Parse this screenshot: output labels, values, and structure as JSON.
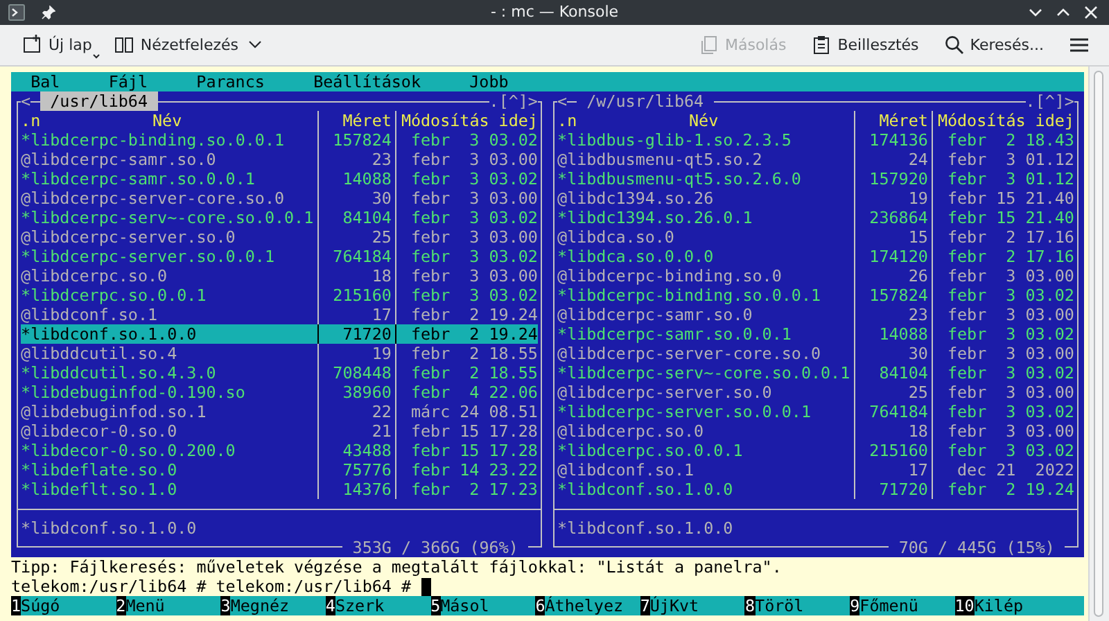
{
  "window": {
    "title": "- : mc — Konsole"
  },
  "toolbar": {
    "left": [
      {
        "kind": "new_tab",
        "label": "Új lap",
        "disabled": false
      },
      {
        "kind": "split_view",
        "label": "Nézetfelezés",
        "disabled": false
      }
    ],
    "right": [
      {
        "kind": "copy",
        "label": "Másolás",
        "disabled": true
      },
      {
        "kind": "paste",
        "label": "Beillesztés",
        "disabled": false
      },
      {
        "kind": "search",
        "label": "Keresés...",
        "disabled": false
      },
      {
        "kind": "menu",
        "disabled": false
      }
    ]
  },
  "menu_bar": [
    "Bal",
    "Fájl",
    "Parancs",
    "Beállítások",
    "Jobb"
  ],
  "left_panel": {
    "nav": "<",
    "path": "/usr/lib64",
    "active": true,
    "history": ".[^]>",
    "columns": [
      ".n",
      "Név",
      "Méret",
      "Módosítás idej"
    ],
    "files": [
      {
        "name": "*libdcerpc-binding.so.0.0.1",
        "size": "157824",
        "modified": "febr  3 03.02",
        "kind": "executable",
        "selected": false
      },
      {
        "name": "@libdcerpc-samr.so.0",
        "size": "23",
        "modified": "febr  3 03.00",
        "kind": "symlink",
        "selected": false
      },
      {
        "name": "*libdcerpc-samr.so.0.0.1",
        "size": "14088",
        "modified": "febr  3 03.02",
        "kind": "executable",
        "selected": false
      },
      {
        "name": "@libdcerpc-server-core.so.0",
        "size": "30",
        "modified": "febr  3 03.00",
        "kind": "symlink",
        "selected": false
      },
      {
        "name": "*libdcerpc-serv~-core.so.0.0.1",
        "size": "84104",
        "modified": "febr  3 03.02",
        "kind": "executable",
        "selected": false
      },
      {
        "name": "@libdcerpc-server.so.0",
        "size": "25",
        "modified": "febr  3 03.00",
        "kind": "symlink",
        "selected": false
      },
      {
        "name": "*libdcerpc-server.so.0.0.1",
        "size": "764184",
        "modified": "febr  3 03.02",
        "kind": "executable",
        "selected": false
      },
      {
        "name": "@libdcerpc.so.0",
        "size": "18",
        "modified": "febr  3 03.00",
        "kind": "symlink",
        "selected": false
      },
      {
        "name": "*libdcerpc.so.0.0.1",
        "size": "215160",
        "modified": "febr  3 03.02",
        "kind": "executable",
        "selected": false
      },
      {
        "name": "@libdconf.so.1",
        "size": "17",
        "modified": "febr  2 19.24",
        "kind": "symlink",
        "selected": false
      },
      {
        "name": "*libdconf.so.1.0.0",
        "size": "71720",
        "modified": "febr  2 19.24",
        "kind": "executable",
        "selected": true
      },
      {
        "name": "@libddcutil.so.4",
        "size": "19",
        "modified": "febr  2 18.55",
        "kind": "symlink",
        "selected": false
      },
      {
        "name": "*libddcutil.so.4.3.0",
        "size": "708448",
        "modified": "febr  2 18.55",
        "kind": "executable",
        "selected": false
      },
      {
        "name": "*libdebuginfod-0.190.so",
        "size": "38960",
        "modified": "febr  4 22.06",
        "kind": "executable",
        "selected": false
      },
      {
        "name": "@libdebuginfod.so.1",
        "size": "22",
        "modified": "márc 24 08.51",
        "kind": "symlink",
        "selected": false
      },
      {
        "name": "@libdecor-0.so.0",
        "size": "21",
        "modified": "febr 15 17.28",
        "kind": "symlink",
        "selected": false
      },
      {
        "name": "*libdecor-0.so.0.200.0",
        "size": "43488",
        "modified": "febr 15 17.28",
        "kind": "executable",
        "selected": false
      },
      {
        "name": "*libdeflate.so.0",
        "size": "75776",
        "modified": "febr 14 23.22",
        "kind": "executable",
        "selected": false
      },
      {
        "name": "*libdeflt.so.1.0",
        "size": "14376",
        "modified": "febr  2 17.23",
        "kind": "executable",
        "selected": false
      }
    ],
    "mini_status": "*libdconf.so.1.0.0",
    "disk_usage": "353G / 366G (96%)"
  },
  "right_panel": {
    "nav": "<",
    "path": "/w/usr/lib64",
    "active": false,
    "history": ".[^]>",
    "columns": [
      ".n",
      "Név",
      "Méret",
      "Módosítás idej"
    ],
    "files": [
      {
        "name": "*libdbus-glib-1.so.2.3.5",
        "size": "174136",
        "modified": "febr  2 18.43",
        "kind": "executable",
        "selected": false
      },
      {
        "name": "@libdbusmenu-qt5.so.2",
        "size": "24",
        "modified": "febr  3 01.12",
        "kind": "symlink",
        "selected": false
      },
      {
        "name": "*libdbusmenu-qt5.so.2.6.0",
        "size": "157920",
        "modified": "febr  3 01.12",
        "kind": "executable",
        "selected": false
      },
      {
        "name": "@libdc1394.so.26",
        "size": "19",
        "modified": "febr 15 21.40",
        "kind": "symlink",
        "selected": false
      },
      {
        "name": "*libdc1394.so.26.0.1",
        "size": "236864",
        "modified": "febr 15 21.40",
        "kind": "executable",
        "selected": false
      },
      {
        "name": "@libdca.so.0",
        "size": "15",
        "modified": "febr  2 17.16",
        "kind": "symlink",
        "selected": false
      },
      {
        "name": "*libdca.so.0.0.0",
        "size": "174120",
        "modified": "febr  2 17.16",
        "kind": "executable",
        "selected": false
      },
      {
        "name": "@libdcerpc-binding.so.0",
        "size": "26",
        "modified": "febr  3 03.00",
        "kind": "symlink",
        "selected": false
      },
      {
        "name": "*libdcerpc-binding.so.0.0.1",
        "size": "157824",
        "modified": "febr  3 03.02",
        "kind": "executable",
        "selected": false
      },
      {
        "name": "@libdcerpc-samr.so.0",
        "size": "23",
        "modified": "febr  3 03.00",
        "kind": "symlink",
        "selected": false
      },
      {
        "name": "*libdcerpc-samr.so.0.0.1",
        "size": "14088",
        "modified": "febr  3 03.02",
        "kind": "executable",
        "selected": false
      },
      {
        "name": "@libdcerpc-server-core.so.0",
        "size": "30",
        "modified": "febr  3 03.00",
        "kind": "symlink",
        "selected": false
      },
      {
        "name": "*libdcerpc-serv~-core.so.0.0.1",
        "size": "84104",
        "modified": "febr  3 03.02",
        "kind": "executable",
        "selected": false
      },
      {
        "name": "@libdcerpc-server.so.0",
        "size": "25",
        "modified": "febr  3 03.00",
        "kind": "symlink",
        "selected": false
      },
      {
        "name": "*libdcerpc-server.so.0.0.1",
        "size": "764184",
        "modified": "febr  3 03.02",
        "kind": "executable",
        "selected": false
      },
      {
        "name": "@libdcerpc.so.0",
        "size": "18",
        "modified": "febr  3 03.00",
        "kind": "symlink",
        "selected": false
      },
      {
        "name": "*libdcerpc.so.0.0.1",
        "size": "215160",
        "modified": "febr  3 03.02",
        "kind": "executable",
        "selected": false
      },
      {
        "name": "@libdconf.so.1",
        "size": "17",
        "modified": " dec 21  2022",
        "kind": "symlink",
        "selected": false
      },
      {
        "name": "*libdconf.so.1.0.0",
        "size": "71720",
        "modified": "febr  2 19.24",
        "kind": "executable",
        "selected": false
      }
    ],
    "mini_status": "*libdconf.so.1.0.0",
    "disk_usage": "70G / 445G (15%)"
  },
  "hint": "Tipp: Fájlkeresés: műveletek végzése a megtalált fájlokkal: \"Listát a panelra\".",
  "command_line": "telekom:/usr/lib64 # telekom:/usr/lib64 #",
  "function_keys": [
    {
      "number": "1",
      "label": "Súgó"
    },
    {
      "number": "2",
      "label": "Menü"
    },
    {
      "number": "3",
      "label": "Megnéz"
    },
    {
      "number": "4",
      "label": "Szerk"
    },
    {
      "number": "5",
      "label": "Másol"
    },
    {
      "number": "6",
      "label": "Áthelyez"
    },
    {
      "number": "7",
      "label": "ÚjKvt"
    },
    {
      "number": "8",
      "label": "Töröl"
    },
    {
      "number": "9",
      "label": "Főmenü"
    },
    {
      "number": "10",
      "label": "Kilép"
    }
  ]
}
